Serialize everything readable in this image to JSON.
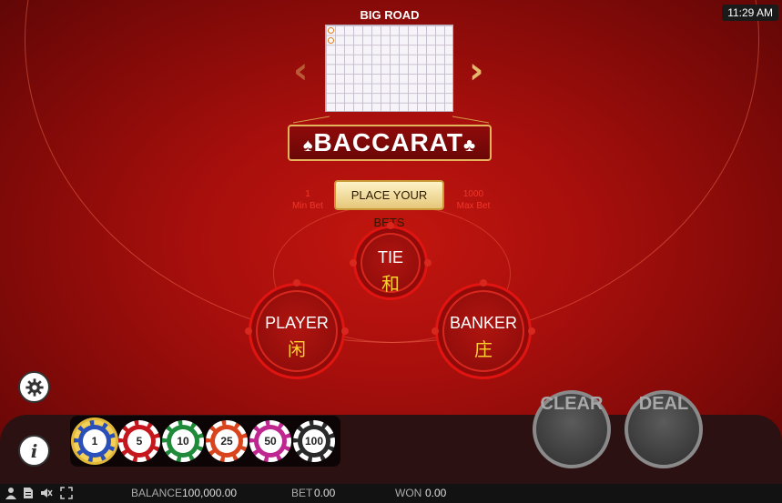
{
  "status_bar_time": "11:29 AM",
  "big_road": {
    "title": "BIG ROAD",
    "results": [
      "tie-marker",
      "tie-marker"
    ]
  },
  "logo": {
    "text": "BACCARAT",
    "suit_left": "♠",
    "suit_right": "♣"
  },
  "place_bets_label": "PLACE YOUR BETS",
  "limits": {
    "min_value": "1",
    "min_label": "Min Bet",
    "max_value": "1000",
    "max_label": "Max Bet"
  },
  "bet_spots": {
    "tie": {
      "label": "TIE",
      "cn": "和"
    },
    "player": {
      "label": "PLAYER",
      "cn": "闲"
    },
    "banker": {
      "label": "BANKER",
      "cn": "庄"
    }
  },
  "chips": [
    {
      "value": "1",
      "color": "#2b4fb8",
      "selected": true
    },
    {
      "value": "5",
      "color": "#c4161c"
    },
    {
      "value": "10",
      "color": "#1f8a3a"
    },
    {
      "value": "25",
      "color": "#d9441c"
    },
    {
      "value": "50",
      "color": "#c0268f"
    },
    {
      "value": "100",
      "color": "#2a2a2a"
    }
  ],
  "buttons": {
    "clear": "CLEAR",
    "deal": "DEAL"
  },
  "icons": {
    "settings": "gear-icon",
    "info": "info-icon",
    "user": "user-icon",
    "document": "document-icon",
    "sound": "sound-muted-icon",
    "fullscreen": "fullscreen-icon"
  },
  "footer": {
    "balance_label": "BALANCE",
    "balance_value": "100,000.00",
    "bet_label": "BET",
    "bet_value": "0.00",
    "won_label": "WON",
    "won_value": "0.00"
  }
}
